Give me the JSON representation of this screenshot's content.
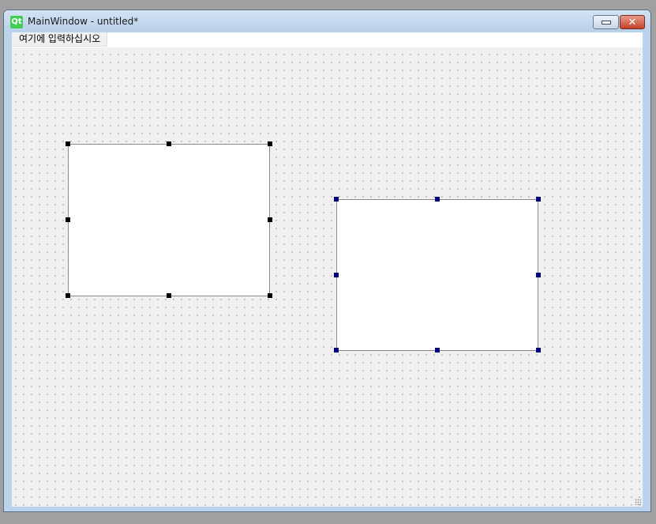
{
  "window": {
    "title": "MainWindow - untitled*",
    "app_icon": "qt-logo-icon",
    "app_icon_text": "Qt"
  },
  "controls": {
    "minimize_icon": "minimize-icon",
    "close_icon": "close-icon",
    "close_glyph": "✕"
  },
  "menubar": {
    "placeholder_item": "여기에 입력하십시오"
  },
  "colors": {
    "unselected_handle": "#000000",
    "selected_handle": "#00007f",
    "widget_fill": "#ffffff",
    "client_bg": "#f0f0f0"
  }
}
